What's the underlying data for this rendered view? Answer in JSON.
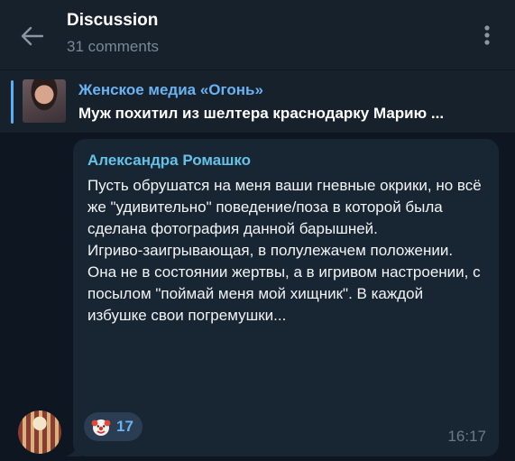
{
  "header": {
    "title": "Discussion",
    "subtitle": "31 comments"
  },
  "pinned": {
    "channel": "Женское медиа «Огонь»",
    "text": "Муж похитил из шелтера краснодарку Марию ..."
  },
  "message": {
    "author": "Александра Ромашко",
    "paragraphs": [
      "Пусть обрушатся на меня ваши гневные окрики, но всё же \"удивительно\" поведение/поза в которой была сделана фотография данной барышней.",
      "Игриво-заигрывающая, в полулежачем положении.",
      "Она не в состоянии жертвы, а в игривом настроении, с посылом \"поймай меня мой хищник\". В каждой избушке свои погремушки..."
    ],
    "reaction": {
      "emoji_icon": "clown-face",
      "count": "17"
    },
    "time": "16:17"
  },
  "colors": {
    "header_bg": "#17212b",
    "chat_bg": "#0e1621",
    "bubble_bg": "#182533",
    "accent": "#6ab3f3",
    "author": "#64c2e8"
  }
}
